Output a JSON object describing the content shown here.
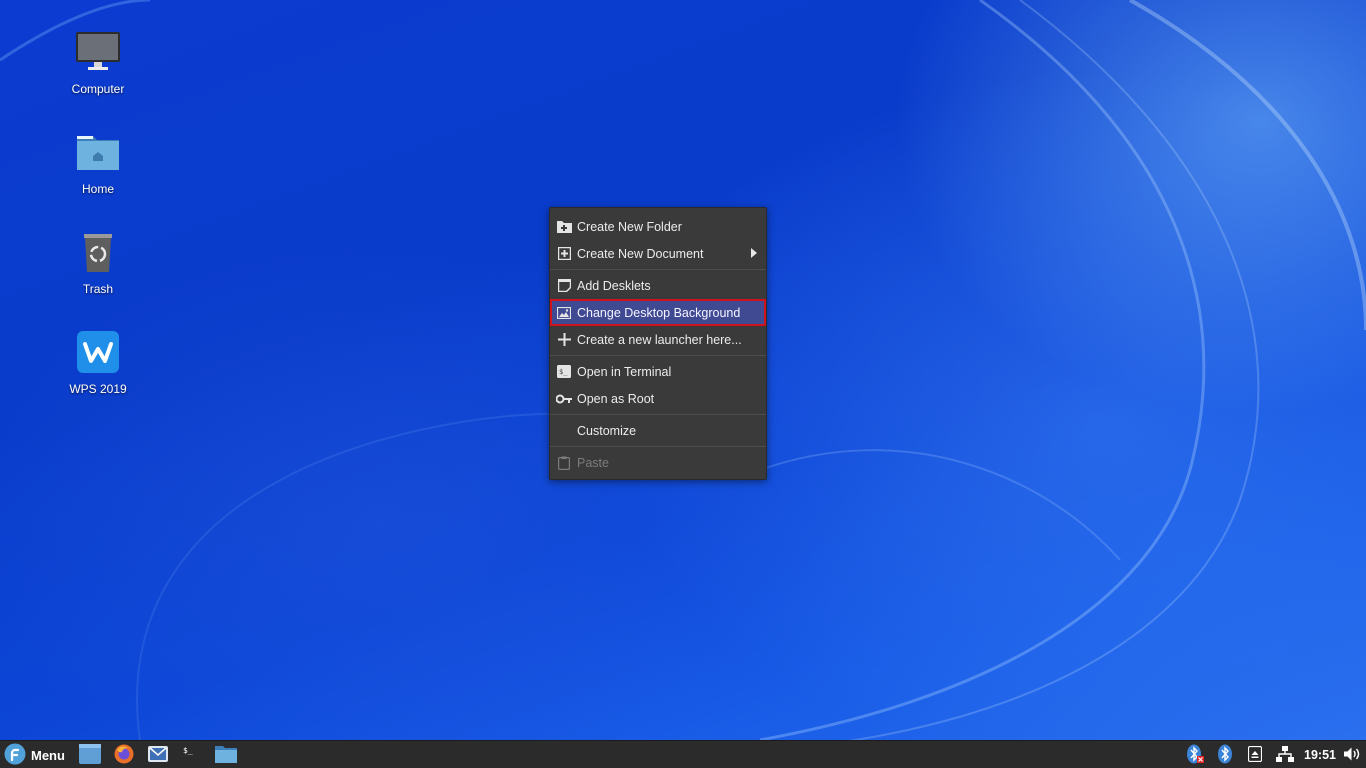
{
  "desktop": {
    "icons": [
      {
        "label": "Computer",
        "icon": "monitor-icon"
      },
      {
        "label": "Home",
        "icon": "home-folder-icon"
      },
      {
        "label": "Trash",
        "icon": "trash-icon"
      },
      {
        "label": "WPS 2019",
        "icon": "wps-office-icon"
      }
    ]
  },
  "context_menu": {
    "items": [
      {
        "label": "Create New Folder",
        "icon": "new-folder-icon"
      },
      {
        "label": "Create New Document",
        "icon": "new-document-icon",
        "submenu": true
      },
      {
        "label": "Add Desklets",
        "icon": "desklet-icon"
      },
      {
        "label": "Change Desktop Background",
        "icon": "image-icon",
        "highlighted": true
      },
      {
        "label": "Create a new launcher here...",
        "icon": "plus-icon"
      },
      {
        "label": "Open in Terminal",
        "icon": "terminal-icon"
      },
      {
        "label": "Open as Root",
        "icon": "key-icon"
      },
      {
        "label": "Customize",
        "icon": ""
      },
      {
        "label": "Paste",
        "icon": "clipboard-icon",
        "disabled": true
      }
    ]
  },
  "taskbar": {
    "menu_label": "Menu",
    "launchers": [
      "files-window-icon",
      "firefox-icon",
      "mail-icon",
      "terminal-icon",
      "folder-icon"
    ],
    "tray": [
      "bluetooth-disabled-icon",
      "bluetooth-icon",
      "eject-icon",
      "network-icon"
    ],
    "clock": "19:51",
    "volume_icon": "volume-icon"
  },
  "colors": {
    "menu_bg": "#3a3a3a",
    "highlight_bg": "#404a93",
    "highlight_outline": "#d0121d",
    "taskbar_bg": "#2b2b2b"
  }
}
